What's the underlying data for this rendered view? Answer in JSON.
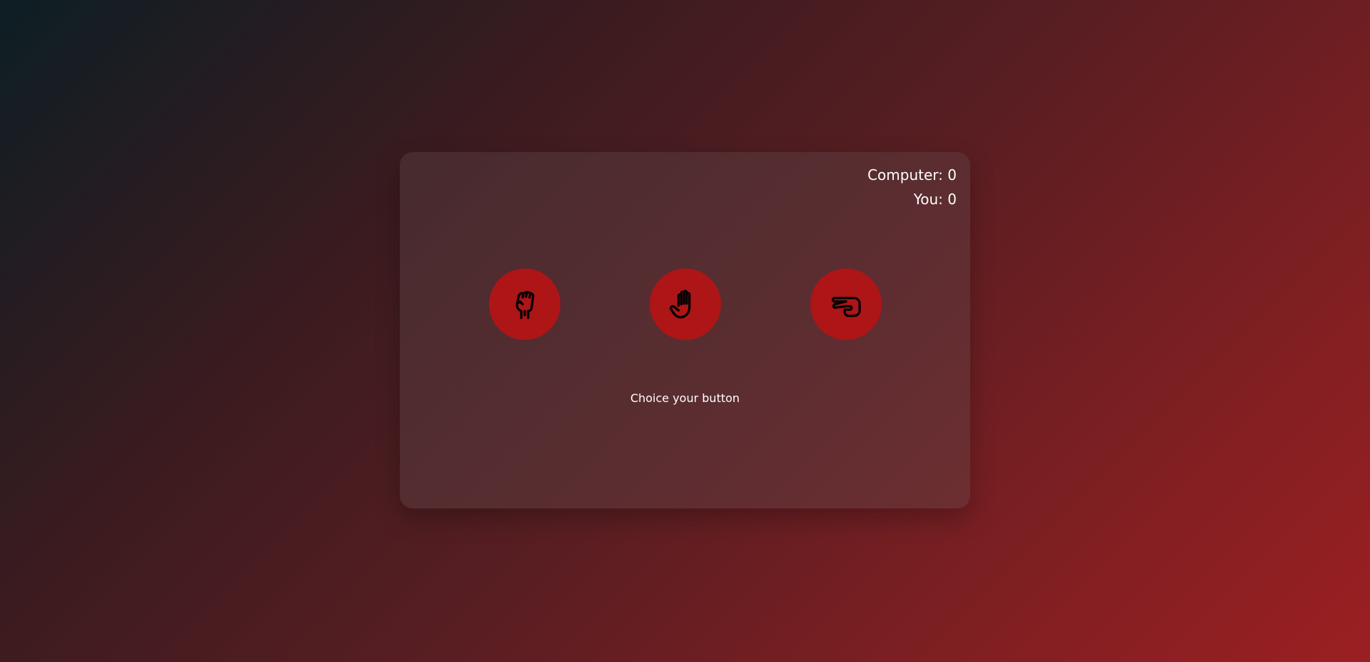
{
  "scoreboard": {
    "computer": "Computer: 0",
    "you": "You: 0"
  },
  "choices": [
    {
      "icon": "hand-rock-icon"
    },
    {
      "icon": "hand-paper-icon"
    },
    {
      "icon": "hand-scissors-icon"
    }
  ],
  "message": "Choice your button",
  "colors": {
    "button": "#ad1517",
    "text": "#ffffff",
    "icon_stroke": "#000000"
  }
}
